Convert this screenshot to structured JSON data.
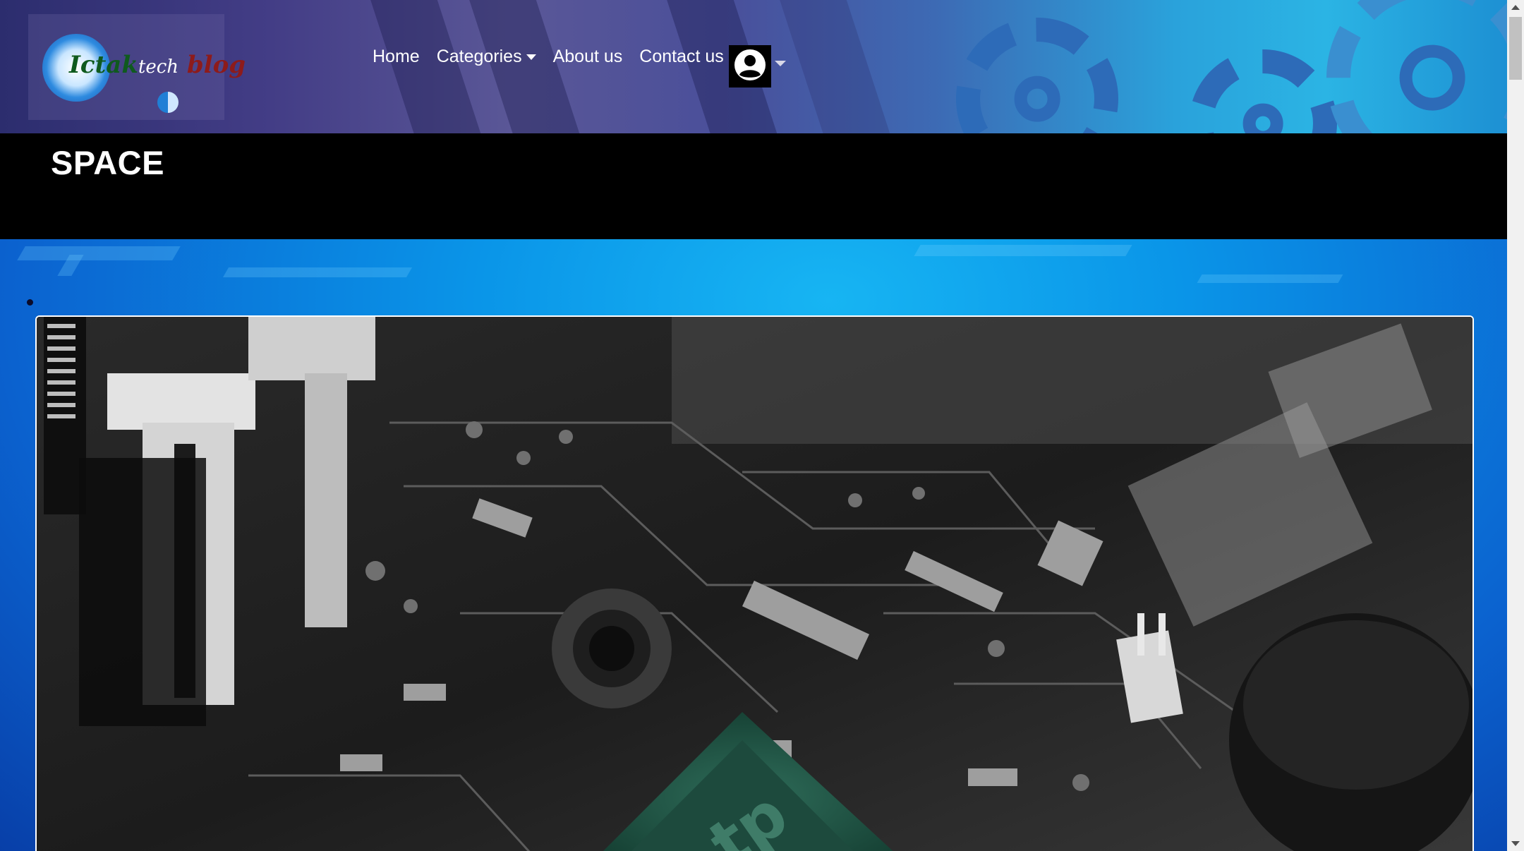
{
  "header": {
    "logo": {
      "alt": "ictaktech blog logo",
      "icon": "ictaktech-logo",
      "text_part1": "Ictak",
      "text_part2": "tech",
      "text_part3": "blog"
    },
    "nav": [
      {
        "label": "Home"
      },
      {
        "label": "Categories",
        "has_dropdown": true
      },
      {
        "label": "About us"
      },
      {
        "label": "Contact us"
      }
    ],
    "user_menu": {
      "icon": "user-avatar-icon",
      "dropdown_icon": "caret-down-icon"
    }
  },
  "page": {
    "title": "SPACE"
  },
  "content": {
    "image": {
      "alt": "circuit board photo",
      "description_icon": "circuit-board-image"
    }
  },
  "colors": {
    "header_gradient_start": "#2c2d6e",
    "header_gradient_end": "#2bb4e4",
    "title_band": "#000000",
    "content_bg": "#0a95e8",
    "text": "#ffffff"
  }
}
